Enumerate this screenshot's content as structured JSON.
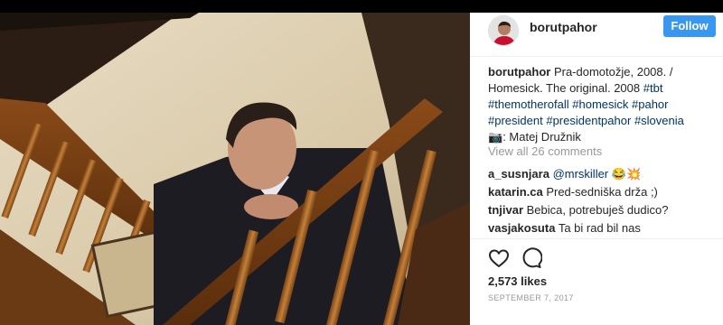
{
  "post": {
    "username": "borutpahor",
    "follow_label": "Follow",
    "caption_text": "Pra-domotožje, 2008. / Homesick. The original. 2008",
    "hashtags_line1": [
      "#tbt"
    ],
    "hashtags_line2": [
      "#themotherofall",
      "#homesick",
      "#pahor"
    ],
    "hashtags_line3": [
      "#president",
      "#presidentpahor",
      "#slovenia"
    ],
    "photo_credit_icon": "camera-emoji",
    "photo_credit": ": Matej Družnik",
    "view_all_comments": "View all 26 comments",
    "likes": "2,573 likes",
    "date": "September 7, 2017"
  },
  "comments": [
    {
      "user": "a_susnjara",
      "mention": "@mrskiller",
      "text": "😂💥"
    },
    {
      "user": "katarin.ca",
      "mention": "",
      "text": "Pred-sedniška drža ;)"
    },
    {
      "user": "tnjivar",
      "mention": "",
      "text": "Bebica, potrebuješ dudico?"
    },
    {
      "user": "vasjakosuta",
      "mention": "",
      "text": "Ta bi rad bil nas"
    }
  ],
  "icons": {
    "like": "heart-icon",
    "comment": "comment-bubble-icon"
  },
  "colors": {
    "accent": "#3897f0",
    "hashtag": "#003569",
    "muted": "#999999"
  }
}
